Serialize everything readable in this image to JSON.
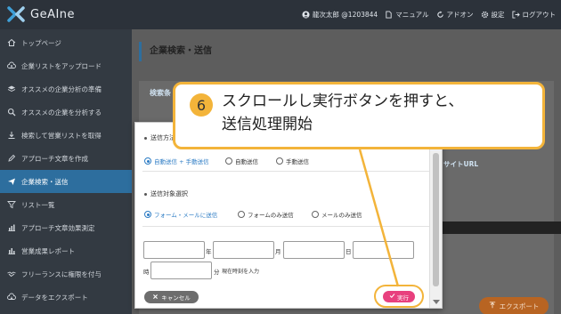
{
  "app": {
    "logo_text": "GeAIne"
  },
  "topnav": {
    "user": "龍次太郎 @1203844",
    "manual": "マニュアル",
    "addon": "アドオン",
    "settings": "設定",
    "logout": "ログアウト"
  },
  "sidebar": {
    "items": [
      {
        "label": "トップページ",
        "icon": "home-icon"
      },
      {
        "label": "企業リストをアップロード",
        "icon": "cloud-upload-icon"
      },
      {
        "label": "オススメの企業分析の準備",
        "icon": "layers-icon"
      },
      {
        "label": "オススメの企業を分析する",
        "icon": "search-icon"
      },
      {
        "label": "検索して営業リストを取得",
        "icon": "download-icon"
      },
      {
        "label": "アプローチ文章を作成",
        "icon": "pencil-icon"
      },
      {
        "label": "企業検索・送信",
        "icon": "send-icon",
        "active": true
      },
      {
        "label": "リスト一覧",
        "icon": "filter-icon"
      },
      {
        "label": "アプローチ文章効果測定",
        "icon": "bar-chart-icon"
      },
      {
        "label": "営業成果レポート",
        "icon": "bar-chart-icon"
      },
      {
        "label": "フリーランスに権限を付与",
        "icon": "handshake-icon"
      },
      {
        "label": "データをエクスポート",
        "icon": "cloud-download-icon"
      }
    ]
  },
  "main": {
    "page_title": "企業検索・送信",
    "panel_title": "検索条",
    "site_url_label": "サイトURL",
    "export_label": "エクスポート"
  },
  "modal": {
    "send_method_label": "送信方法",
    "send_methods": [
      {
        "label": "自動送信 + 手動送信",
        "checked": true
      },
      {
        "label": "自動送信",
        "checked": false
      },
      {
        "label": "手動送信",
        "checked": false
      }
    ],
    "target_label": "送信対象選択",
    "targets": [
      {
        "label": "フォーム・メールに送信",
        "checked": true
      },
      {
        "label": "フォームのみ送信",
        "checked": false
      },
      {
        "label": "メールのみ送信",
        "checked": false
      }
    ],
    "date_units": {
      "year": "年",
      "month": "月",
      "day": "日",
      "hour": "時",
      "minute": "分"
    },
    "current_time_hint": "現在時刻を入力",
    "cancel_label": "キャンセル",
    "execute_label": "実行"
  },
  "callout": {
    "number": "6",
    "text_line1": "スクロールし実行ボタンを押すと、",
    "text_line2": "送信処理開始"
  },
  "colors": {
    "accent": "#2d6e9e",
    "callout_border": "#f3b43a",
    "execute": "#e8407e",
    "export": "#b86422"
  }
}
